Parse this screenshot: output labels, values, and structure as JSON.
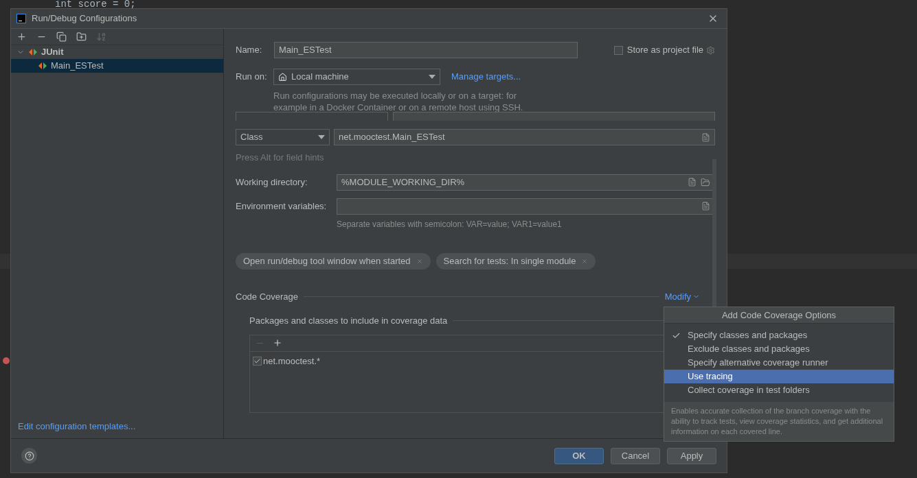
{
  "editor": {
    "code_line": "int score = 0;"
  },
  "window": {
    "title": "Run/Debug Configurations"
  },
  "toolbar": {
    "items": [
      {
        "kind": "add",
        "disabled": false
      },
      {
        "kind": "remove",
        "disabled": false
      },
      {
        "kind": "copy",
        "disabled": false
      },
      {
        "kind": "folder",
        "disabled": false
      },
      {
        "kind": "sort",
        "disabled": true
      }
    ]
  },
  "tree": [
    {
      "label": "JUnit",
      "expanded": true,
      "selected": false,
      "children": [
        {
          "label": "Main_ESTest",
          "selected": true
        }
      ]
    }
  ],
  "edit_templates_link": "Edit configuration templates...",
  "form": {
    "name_label": "Name:",
    "name_value": "Main_ESTest",
    "store_label": "Store as project file",
    "store_checked": false,
    "run_on_label": "Run on:",
    "run_on_value": "Local machine",
    "manage_targets": "Manage targets...",
    "run_on_hint": "Run configurations may be executed locally or on a target: for example in a Docker Container or on a remote host using SSH.",
    "test_kind": "Class",
    "class_value": "net.mooctest.Main_ESTest",
    "field_hints": "Press Alt for field hints",
    "workdir_label": "Working directory:",
    "workdir_value": "%MODULE_WORKING_DIR%",
    "env_label": "Environment variables:",
    "env_hint": "Separate variables with semicolon: VAR=value; VAR1=value1",
    "tags": [
      "Open run/debug tool window when started",
      "Search for tests: In single module"
    ],
    "coverage_title": "Code Coverage",
    "modify": "Modify",
    "packages_title": "Packages and classes to include in coverage data",
    "patterns": [
      {
        "label": "net.mooctest.*",
        "checked": true
      }
    ]
  },
  "popup": {
    "title": "Add Code Coverage Options",
    "items": [
      {
        "label": "Specify classes and packages",
        "checked": true,
        "selected": false
      },
      {
        "label": "Exclude classes and packages",
        "checked": false,
        "selected": false
      },
      {
        "label": "Specify alternative coverage runner",
        "checked": false,
        "selected": false
      },
      {
        "label": "Use tracing",
        "checked": false,
        "selected": true
      },
      {
        "label": "Collect coverage in test folders",
        "checked": false,
        "selected": false
      }
    ],
    "description": "Enables accurate collection of the branch coverage with the ability to track tests, view coverage statistics, and get additional information on each covered line."
  },
  "buttons": [
    {
      "label": "OK",
      "kind": "primary"
    },
    {
      "label": "Cancel",
      "kind": "normal"
    },
    {
      "label": "Apply",
      "kind": "normal"
    }
  ]
}
